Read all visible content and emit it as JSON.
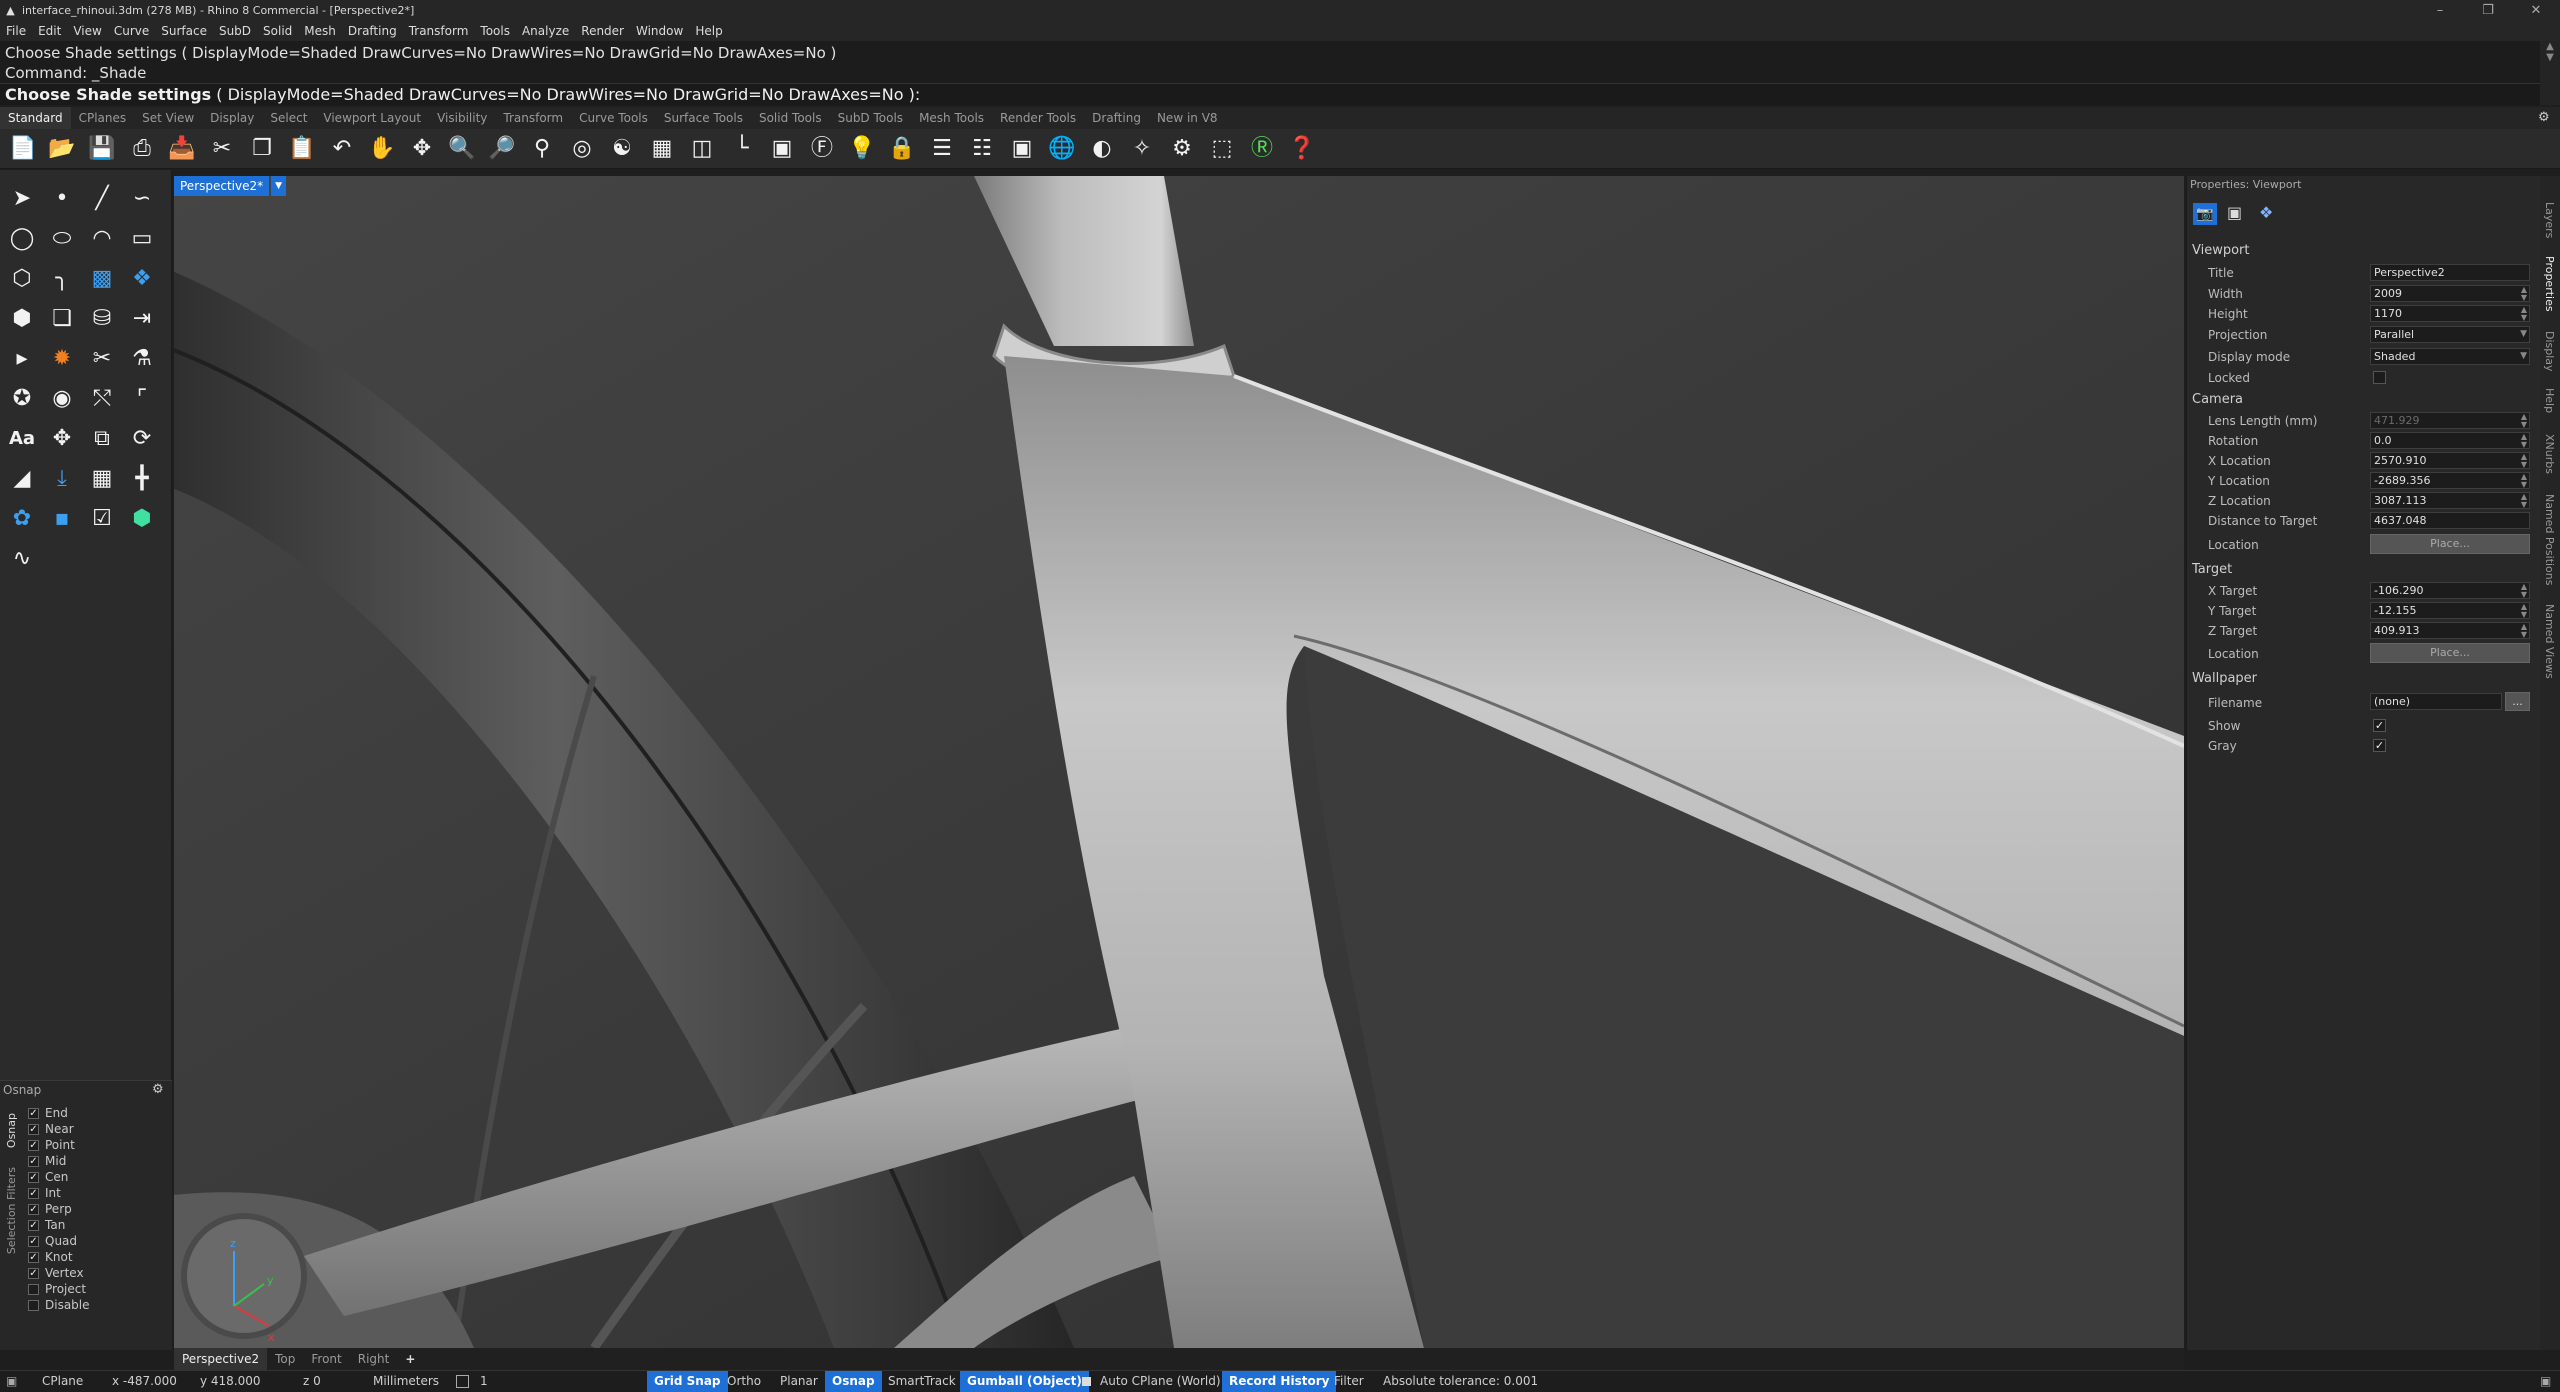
{
  "window": {
    "title": "interface_rhinoui.3dm (278 MB) - Rhino 8 Commercial - [Perspective2*]"
  },
  "menu": [
    "File",
    "Edit",
    "View",
    "Curve",
    "Surface",
    "SubD",
    "Solid",
    "Mesh",
    "Drafting",
    "Transform",
    "Tools",
    "Analyze",
    "Render",
    "Window",
    "Help"
  ],
  "command": {
    "history1": "Choose Shade settings ( DisplayMode=Shaded  DrawCurves=No  DrawWires=No  DrawGrid=No  DrawAxes=No )",
    "history2": "Command: _Shade",
    "prompt_label": "Choose Shade settings",
    "prompt_options": "( DisplayMode=Shaded  DrawCurves=No  DrawWires=No  DrawGrid=No  DrawAxes=No ):"
  },
  "toolbar_tabs": [
    "Standard",
    "CPlanes",
    "Set View",
    "Display",
    "Select",
    "Viewport Layout",
    "Visibility",
    "Transform",
    "Curve Tools",
    "Surface Tools",
    "Solid Tools",
    "SubD Tools",
    "Mesh Tools",
    "Render Tools",
    "Drafting",
    "New in V8"
  ],
  "viewport": {
    "tab": "Perspective2*",
    "axis_x": "x",
    "axis_y": "y",
    "axis_z": "z"
  },
  "viewport_tabs": [
    "Perspective2",
    "Top",
    "Front",
    "Right"
  ],
  "osnap": {
    "title": "Osnap",
    "tab_osnap": "Osnap",
    "tab_filters": "Selection Filters",
    "items": [
      {
        "label": "End",
        "checked": true
      },
      {
        "label": "Near",
        "checked": true
      },
      {
        "label": "Point",
        "checked": true
      },
      {
        "label": "Mid",
        "checked": true
      },
      {
        "label": "Cen",
        "checked": true
      },
      {
        "label": "Int",
        "checked": true
      },
      {
        "label": "Perp",
        "checked": true
      },
      {
        "label": "Tan",
        "checked": true
      },
      {
        "label": "Quad",
        "checked": true
      },
      {
        "label": "Knot",
        "checked": true
      },
      {
        "label": "Vertex",
        "checked": true
      },
      {
        "label": "Project",
        "checked": false
      },
      {
        "label": "Disable",
        "checked": false
      }
    ]
  },
  "properties": {
    "header": "Properties: Viewport",
    "viewport_section": "Viewport",
    "title_label": "Title",
    "title_value": "Perspective2",
    "width_label": "Width",
    "width_value": "2009",
    "height_label": "Height",
    "height_value": "1170",
    "projection_label": "Projection",
    "projection_value": "Parallel",
    "display_label": "Display mode",
    "display_value": "Shaded",
    "locked_label": "Locked",
    "camera_section": "Camera",
    "lens_label": "Lens Length (mm)",
    "lens_value": "471.929",
    "rotation_label": "Rotation",
    "rotation_value": "0.0",
    "xloc_label": "X Location",
    "xloc_value": "2570.910",
    "yloc_label": "Y Location",
    "yloc_value": "-2689.356",
    "zloc_label": "Z Location",
    "zloc_value": "3087.113",
    "dist_label": "Distance to Target",
    "dist_value": "4637.048",
    "location_label": "Location",
    "place_label": "Place...",
    "target_section": "Target",
    "xt_label": "X Target",
    "xt_value": "-106.290",
    "yt_label": "Y Target",
    "yt_value": "-12.155",
    "zt_label": "Z Target",
    "zt_value": "409.913",
    "wall_section": "Wallpaper",
    "file_label": "Filename",
    "file_value": "(none)",
    "file_btn": "...",
    "show_label": "Show",
    "gray_label": "Gray"
  },
  "right_tabs": [
    "Layers",
    "Properties",
    "Display",
    "Help",
    "XNurbs",
    "Named Positions",
    "Named Views"
  ],
  "status": {
    "cplane": "CPlane",
    "x": "x -487.000",
    "y": "y 418.000",
    "z": "z 0",
    "units": "Millimeters",
    "layer": "1",
    "grid_snap": "Grid Snap",
    "ortho": "Ortho",
    "planar": "Planar",
    "osnap": "Osnap",
    "smarttrack": "SmartTrack",
    "gumball": "Gumball (Object)",
    "autocplane": "Auto CPlane (World)",
    "record": "Record History",
    "filter": "Filter",
    "tolerance": "Absolute tolerance: 0.001"
  },
  "colors": {
    "accent": "#1e6fd6",
    "panel": "#2b2b2b",
    "viewport_bg": "#3b3b3b"
  }
}
